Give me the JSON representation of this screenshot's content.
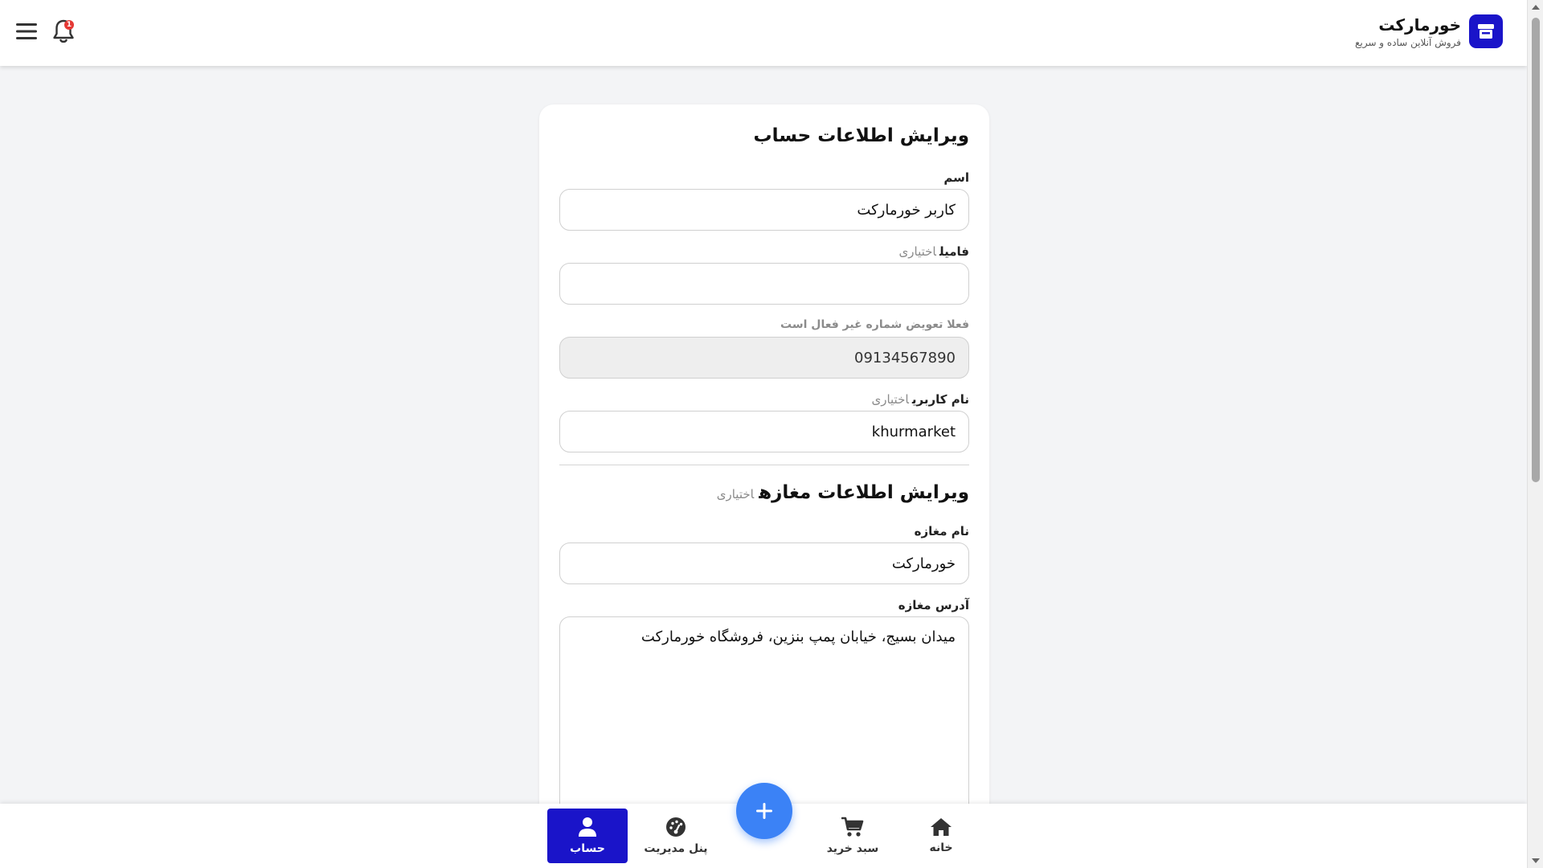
{
  "header": {
    "brand_title": "خورمارکت",
    "brand_subtitle": "فروش آنلاین ساده و سریع",
    "notification_count": "1"
  },
  "form": {
    "title": "ویرایش اطلاعات حساب",
    "first_name": {
      "label": "اسم",
      "value": "کاربر خورمارکت"
    },
    "last_name": {
      "label": "فامیل",
      "optional": "اختیاری",
      "value": ""
    },
    "phone": {
      "label": "فعلا تعویض شماره غیر فعال است",
      "value": "09134567890"
    },
    "username": {
      "label": "نام کاربری",
      "optional": "اختیاری",
      "value": "khurmarket"
    },
    "shop_section": {
      "title": "ویرایش اطلاعات مغازه",
      "optional": "اختیاری",
      "shop_name": {
        "label": "نام مغازه",
        "value": "خورمارکت"
      },
      "shop_address": {
        "label": "آدرس مغازه",
        "value": "میدان بسیج، خیابان پمپ بنزین، فروشگاه خورمارکت"
      }
    }
  },
  "bottom_nav": {
    "home": "خانه",
    "cart": "سبد خرید",
    "dashboard": "پنل مدیریت",
    "account": "حساب",
    "active": "account"
  },
  "colors": {
    "brand": "#1a14c9",
    "fab": "#3b82f6",
    "badge": "#e53935"
  }
}
